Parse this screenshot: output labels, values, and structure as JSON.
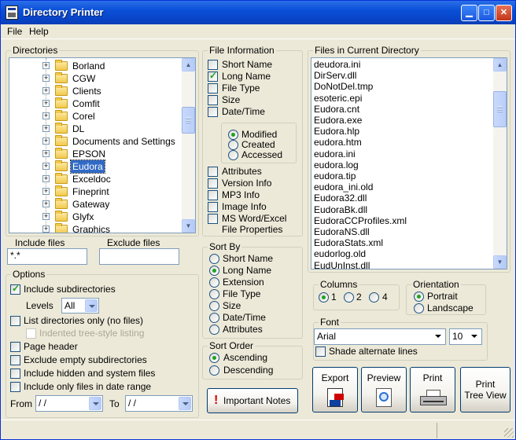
{
  "window": {
    "title": "Directory Printer"
  },
  "menu": {
    "file": "File",
    "help": "Help"
  },
  "directories": {
    "legend": "Directories",
    "items": [
      "Borland",
      "CGW",
      "Clients",
      "Comfit",
      "Corel",
      "DL",
      "Documents and Settings",
      "EPSON",
      "Eudora",
      "Exceldoc",
      "Fineprint",
      "Gateway",
      "Glyfx",
      "Graphics"
    ],
    "selected": "Eudora"
  },
  "include_files": {
    "label": "Include files",
    "value": "*.*"
  },
  "exclude_files": {
    "label": "Exclude files",
    "value": ""
  },
  "options": {
    "legend": "Options",
    "include_subdirectories": "Include subdirectories",
    "levels_label": "Levels",
    "levels_value": "All",
    "list_dirs_only": "List directories only (no files)",
    "indented_tree": "Indented tree-style listing",
    "page_header": "Page header",
    "exclude_empty": "Exclude empty subdirectories",
    "include_hidden": "Include hidden and system files",
    "include_date_range": "Include only files in date range",
    "from_label": "From",
    "from_value": " /  /",
    "to_label": "To",
    "to_value": " /  /"
  },
  "file_info": {
    "legend": "File Information",
    "short_name": "Short Name",
    "long_name": "Long Name",
    "file_type": "File Type",
    "size": "Size",
    "date_time": "Date/Time",
    "modified": "Modified",
    "created": "Created",
    "accessed": "Accessed",
    "attributes": "Attributes",
    "version_info": "Version Info",
    "mp3_info": "MP3 Info",
    "image_info": "Image Info",
    "ms_word_excel": "MS Word/Excel",
    "file_properties": "File Properties"
  },
  "sort_by": {
    "legend": "Sort By",
    "options": [
      "Short Name",
      "Long Name",
      "Extension",
      "File Type",
      "Size",
      "Date/Time",
      "Attributes"
    ],
    "selected": "Long Name"
  },
  "sort_order": {
    "legend": "Sort Order",
    "ascending": "Ascending",
    "descending": "Descending",
    "selected": "Ascending"
  },
  "important_notes": {
    "label": "Important Notes"
  },
  "files": {
    "legend": "Files in Current Directory",
    "items": [
      "deudora.ini",
      "DirServ.dll",
      "DoNotDel.tmp",
      "esoteric.epi",
      "Eudora.cnt",
      "Eudora.exe",
      "Eudora.hlp",
      "eudora.htm",
      "eudora.ini",
      "eudora.log",
      "eudora.tip",
      "eudora_ini.old",
      "Eudora32.dll",
      "EudoraBk.dll",
      "EudoraCCProfiles.xml",
      "EudoraNS.dll",
      "EudoraStats.xml",
      "eudorlog.old",
      "EudUnInst.dll"
    ]
  },
  "columns": {
    "legend": "Columns",
    "options": [
      "1",
      "2",
      "4"
    ],
    "selected": "1"
  },
  "orientation": {
    "legend": "Orientation",
    "portrait": "Portrait",
    "landscape": "Landscape",
    "selected": "Portrait"
  },
  "font": {
    "legend": "Font",
    "name": "Arial",
    "size": "10",
    "shade_alternate": "Shade alternate lines"
  },
  "buttons": {
    "export": "Export",
    "preview": "Preview",
    "print": "Print",
    "print_tree_line1": "Print",
    "print_tree_line2": "Tree View"
  }
}
